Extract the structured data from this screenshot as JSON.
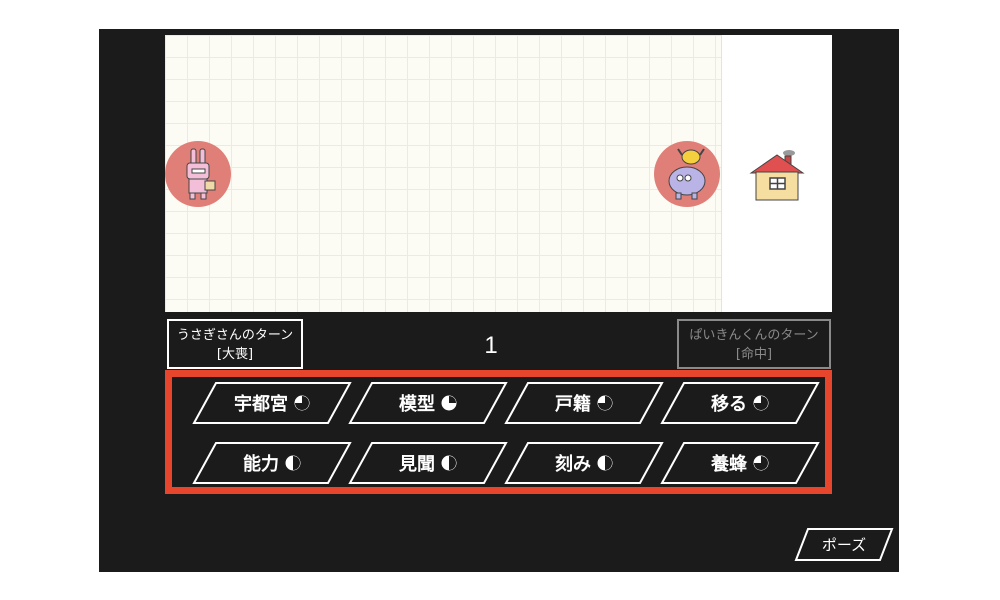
{
  "players": {
    "left": {
      "turn_label": "うさぎさんのターン",
      "status": "[大喪]",
      "active": true
    },
    "right": {
      "turn_label": "ぱいきんくんのターン",
      "status": "[命中]",
      "active": false
    }
  },
  "turn_number": "1",
  "choices": [
    {
      "label": "宇都宮",
      "timer_fraction": 0.75
    },
    {
      "label": "模型",
      "timer_fraction": 0.25
    },
    {
      "label": "戸籍",
      "timer_fraction": 0.75
    },
    {
      "label": "移る",
      "timer_fraction": 0.75
    },
    {
      "label": "能力",
      "timer_fraction": 0.5
    },
    {
      "label": "見聞",
      "timer_fraction": 0.5
    },
    {
      "label": "刻み",
      "timer_fraction": 0.5
    },
    {
      "label": "養蜂",
      "timer_fraction": 0.75
    }
  ],
  "pause_label": "ポーズ",
  "colors": {
    "background": "#1b1b1b",
    "board": "#fcfcf4",
    "piece": "#e07f78",
    "choice_border": "#e8452d",
    "text": "#ffffff"
  }
}
